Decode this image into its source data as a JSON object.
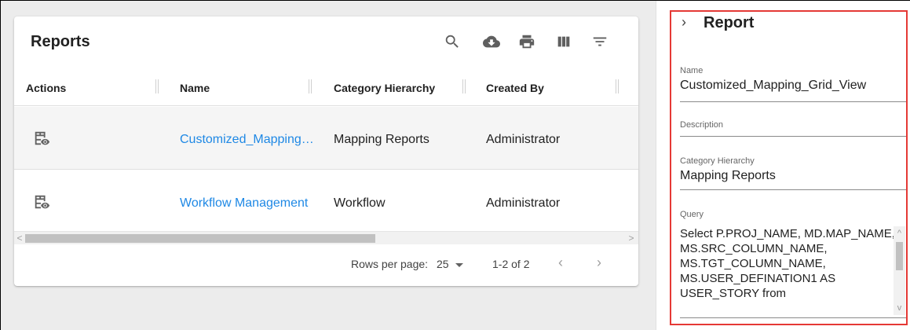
{
  "reports_panel": {
    "title": "Reports",
    "toolbar": {
      "search_icon": "search-icon",
      "download_icon": "cloud-download-icon",
      "print_icon": "print-icon",
      "columns_icon": "view-column-icon",
      "filter_icon": "filter-list-icon"
    },
    "columns": [
      "Actions",
      "Name",
      "Category Hierarchy",
      "Created By"
    ],
    "rows": [
      {
        "action_icon": "table-view-icon",
        "name": "Customized_Mapping…",
        "category": "Mapping Reports",
        "created_by": "Administrator"
      },
      {
        "action_icon": "table-view-icon",
        "name": "Workflow Management",
        "category": "Workflow",
        "created_by": "Administrator"
      }
    ],
    "pagination": {
      "rows_per_page_label": "Rows per page:",
      "rows_per_page": "25",
      "range": "1-2 of 2",
      "prev": "‹",
      "next": "›"
    }
  },
  "report_detail": {
    "chevron": "›",
    "title": "Report",
    "fields": {
      "name": {
        "label": "Name",
        "value": "Customized_Mapping_Grid_View"
      },
      "description": {
        "label": "Description",
        "value": ""
      },
      "category": {
        "label": "Category Hierarchy",
        "value": "Mapping Reports"
      },
      "query": {
        "label": "Query",
        "lines": [
          "Select P.PROJ_NAME, MD.MAP_NAME,",
          "MS.SRC_COLUMN_NAME,",
          "MS.TGT_COLUMN_NAME,",
          "MS.USER_DEFINATION1 AS",
          "USER_STORY from"
        ]
      }
    }
  },
  "colors": {
    "link": "#1e88e5",
    "highlight": "#e53935",
    "background": "#ececec"
  }
}
